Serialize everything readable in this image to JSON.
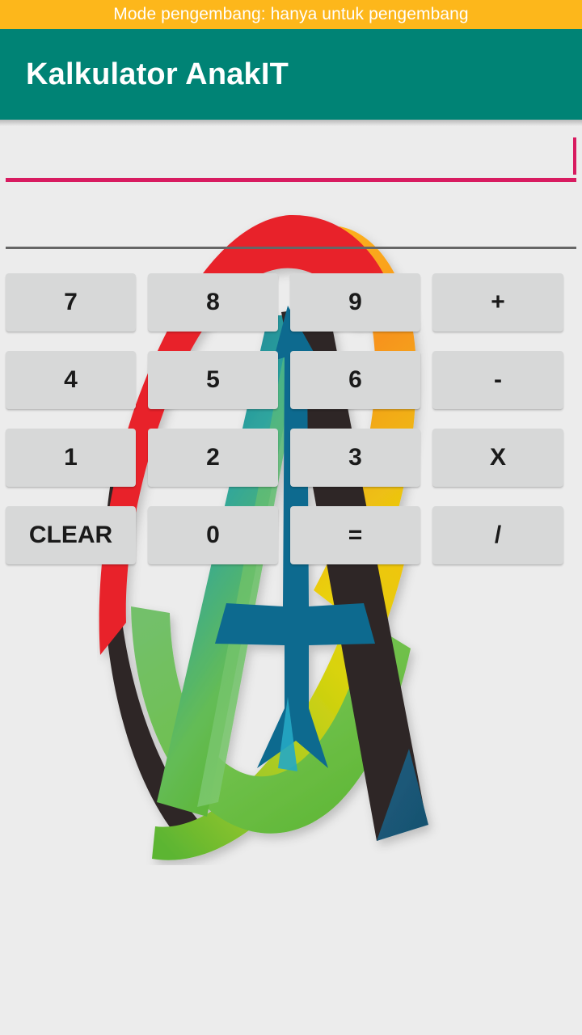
{
  "dev_banner": {
    "text": "Mode pengembang: hanya untuk pengembang",
    "bg_color": "#FDB71B",
    "text_color": "#FFFFFF"
  },
  "appbar": {
    "title": "Kalkulator AnakIT",
    "bg_color": "#008375",
    "text_color": "#FFFFFF"
  },
  "display": {
    "value": "",
    "placeholder": "",
    "underline_color": "#D81B60",
    "caret_color": "#D81B60",
    "divider_color": "#666666"
  },
  "keypad": {
    "button_bg": "#D7D8D8",
    "button_text_color": "#1A1A1A",
    "rows": [
      [
        {
          "label": "7",
          "name": "key-7",
          "type": "digit"
        },
        {
          "label": "8",
          "name": "key-8",
          "type": "digit"
        },
        {
          "label": "9",
          "name": "key-9",
          "type": "digit"
        },
        {
          "label": "+",
          "name": "key-plus",
          "type": "operator"
        }
      ],
      [
        {
          "label": "4",
          "name": "key-4",
          "type": "digit"
        },
        {
          "label": "5",
          "name": "key-5",
          "type": "digit"
        },
        {
          "label": "6",
          "name": "key-6",
          "type": "digit"
        },
        {
          "label": "-",
          "name": "key-minus",
          "type": "operator"
        }
      ],
      [
        {
          "label": "1",
          "name": "key-1",
          "type": "digit"
        },
        {
          "label": "2",
          "name": "key-2",
          "type": "digit"
        },
        {
          "label": "3",
          "name": "key-3",
          "type": "digit"
        },
        {
          "label": "X",
          "name": "key-multiply",
          "type": "operator"
        }
      ],
      [
        {
          "label": "CLEAR",
          "name": "key-clear",
          "type": "action"
        },
        {
          "label": "0",
          "name": "key-0",
          "type": "digit"
        },
        {
          "label": "=",
          "name": "key-equals",
          "type": "action"
        },
        {
          "label": "/",
          "name": "key-divide",
          "type": "operator"
        }
      ]
    ]
  },
  "logo": {
    "name": "anakit-ribbon-logo",
    "colors": {
      "red": "#E8232A",
      "orange": "#F7941E",
      "amber": "#FDB71B",
      "yellow": "#E8D90B",
      "green": "#5CB531",
      "teal": "#2BA8A0",
      "blue": "#116A8F",
      "dark": "#2F2725"
    }
  },
  "background_color": "#ECECEC"
}
